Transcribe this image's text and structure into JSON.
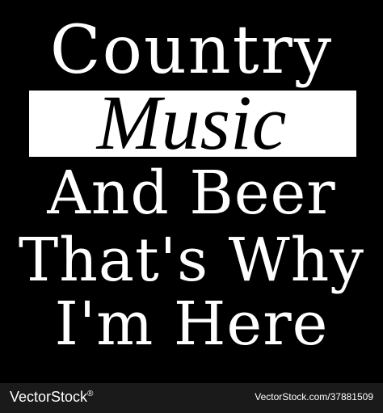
{
  "design": {
    "line1": "Country",
    "line2": "Music",
    "line3": "And Beer",
    "line4": "That's Why",
    "line5": "I'm Here"
  },
  "footer": {
    "brand": "VectorStock",
    "registered": "®",
    "image_id": "VectorStock.com/37881509"
  },
  "colors": {
    "background": "#000000",
    "text": "#ffffff",
    "banner": "#ffffff",
    "banner_text": "#000000"
  }
}
